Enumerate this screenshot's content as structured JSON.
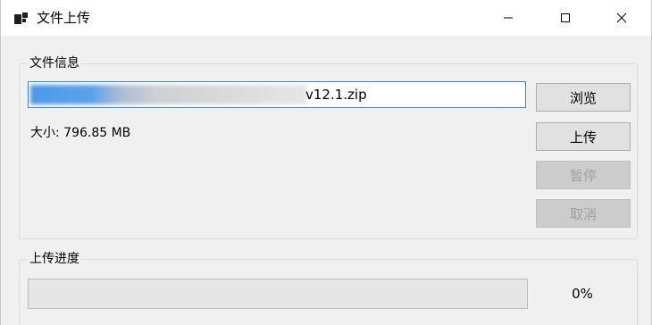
{
  "window": {
    "title": "文件上传",
    "icon": "app-window-icon",
    "controls": [
      "minimize-icon",
      "maximize-icon",
      "close-icon"
    ]
  },
  "file_group": {
    "legend": "文件信息",
    "path_visible_suffix": "v12.1.zip",
    "size_label": "大小: 796.85 MB"
  },
  "buttons": {
    "browse": "浏览",
    "upload": "上传",
    "pause": "暂停",
    "cancel": "取消"
  },
  "progress_group": {
    "legend": "上传进度",
    "percent_text": "0%",
    "value": 0
  },
  "colors": {
    "path_border": "#3b87c8",
    "disabled_button": "#cccccc",
    "progress_fill": "#06b025"
  }
}
